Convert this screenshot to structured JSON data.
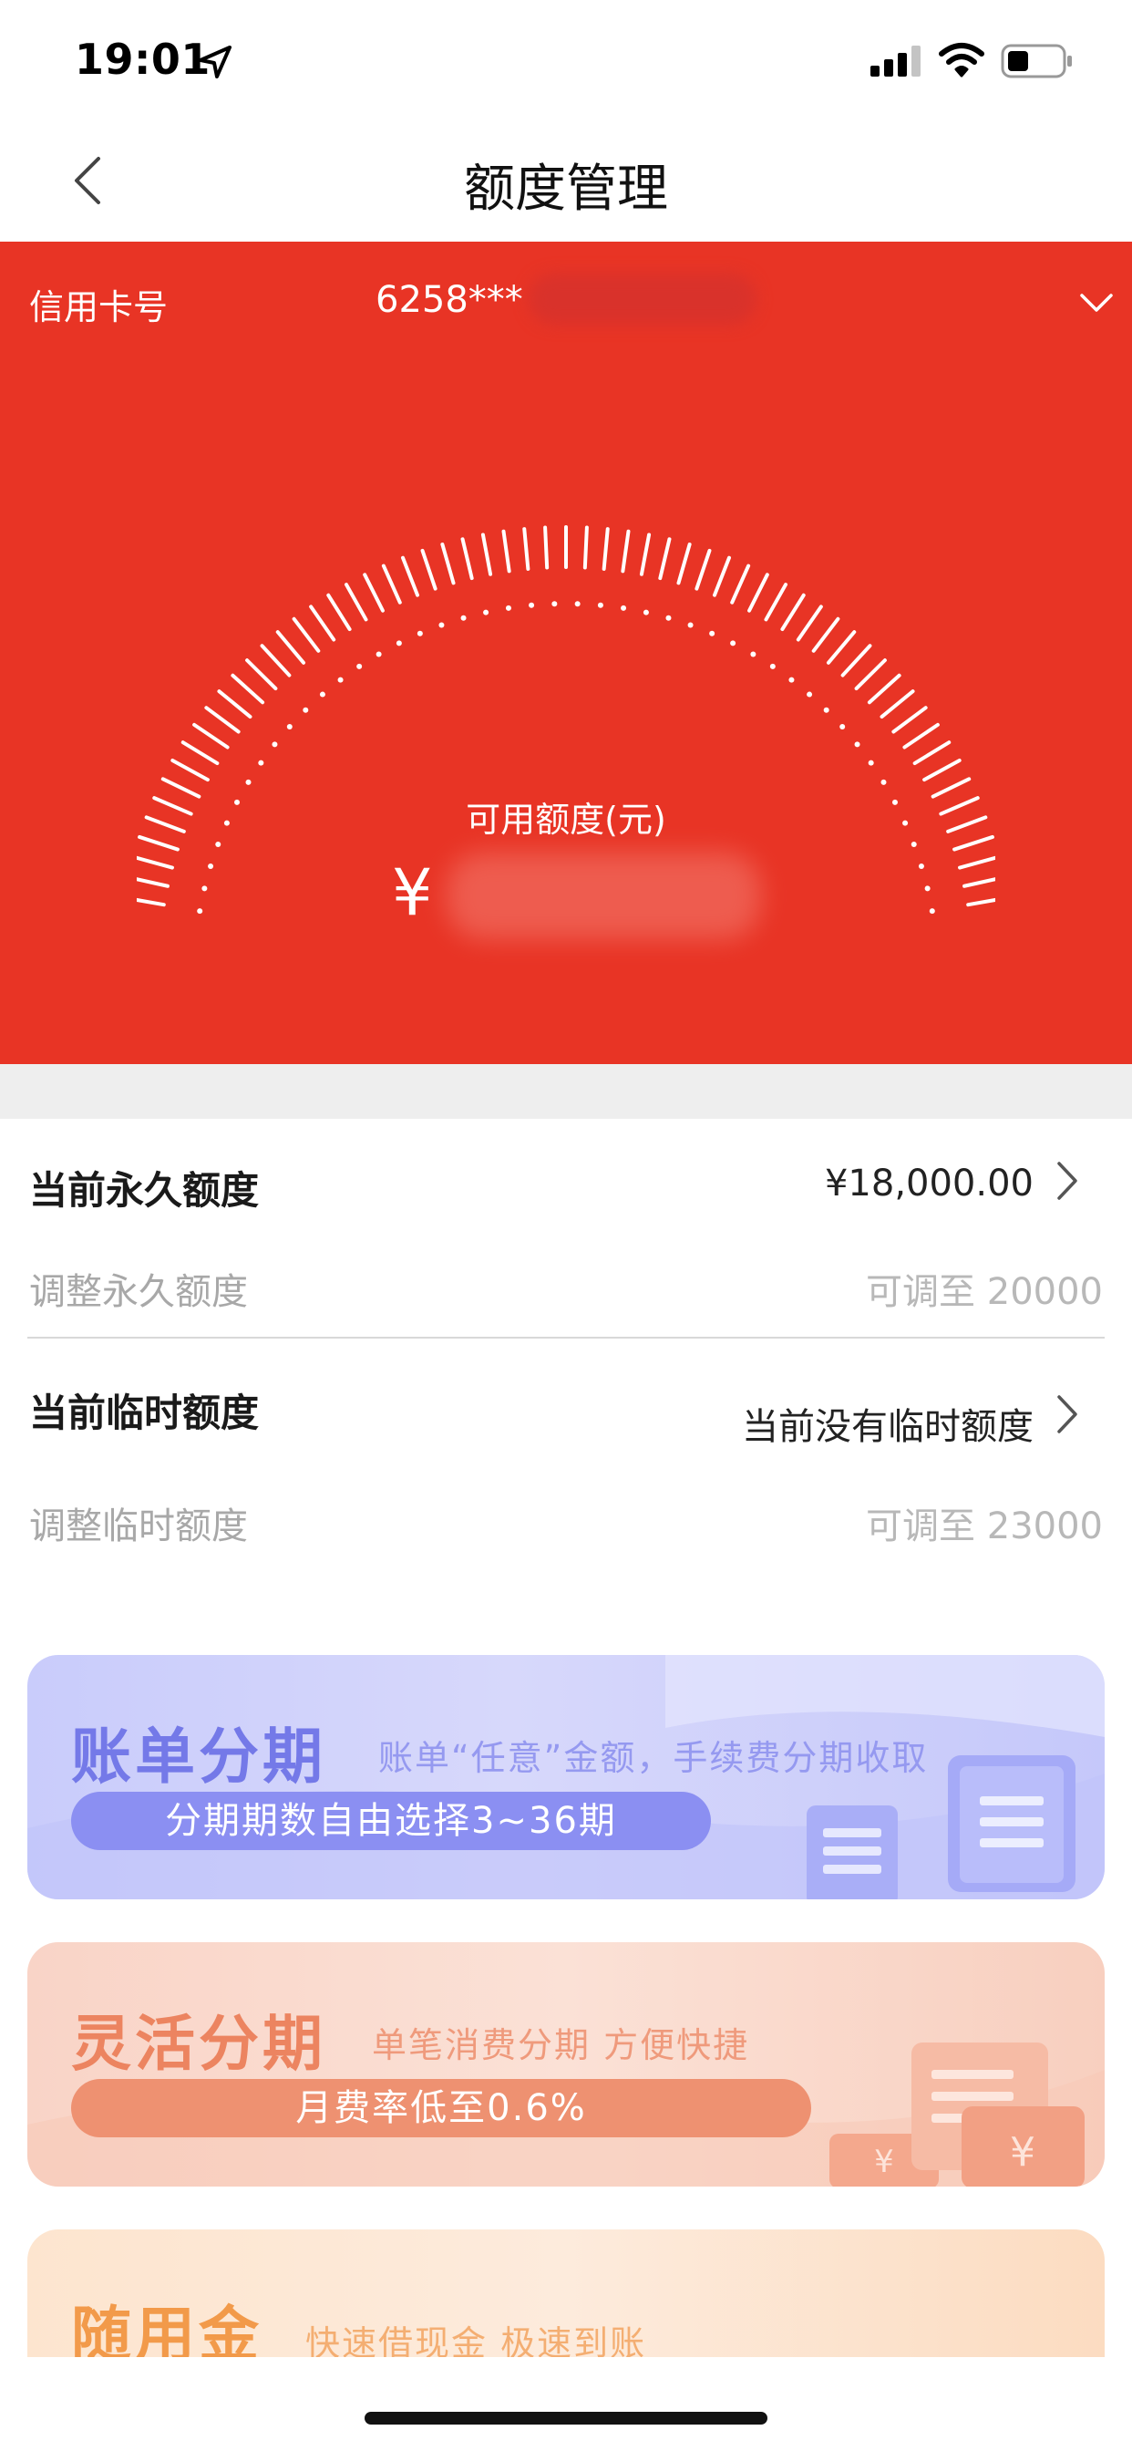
{
  "status_bar": {
    "time": "19:01"
  },
  "nav": {
    "title": "额度管理"
  },
  "card": {
    "label": "信用卡号",
    "number_masked": "6258***",
    "available_label": "可用额度(元)",
    "currency": "¥"
  },
  "limits": {
    "permanent": {
      "title": "当前永久额度",
      "value": "¥18,000.00",
      "adjust_label": "调整永久额度",
      "adjust_value": "可调至 20000"
    },
    "temporary": {
      "title": "当前临时额度",
      "value": "当前没有临时额度",
      "adjust_label": "调整临时额度",
      "adjust_value": "可调至 23000"
    }
  },
  "promos": [
    {
      "title": "账单分期",
      "desc": "账单“任意”金额，手续费分期收取",
      "pill": "分期期数自由选择3~36期"
    },
    {
      "title": "灵活分期",
      "desc": "单笔消费分期 方便快捷",
      "pill": "月费率低至0.6%"
    },
    {
      "title": "随用金",
      "desc": "快速借现金 极速到账"
    }
  ],
  "colors": {
    "hero_red": "#e83425",
    "promo_blue_text": "#7479e8",
    "promo_orange_text": "#ec8460",
    "promo_gold_text": "#f29a4a"
  },
  "icons": [
    "location-arrow-icon",
    "signal-icon",
    "wifi-icon",
    "battery-icon",
    "back-icon",
    "chevron-down-icon",
    "chevron-right-icon",
    "document-icon",
    "yen-card-icon"
  ]
}
